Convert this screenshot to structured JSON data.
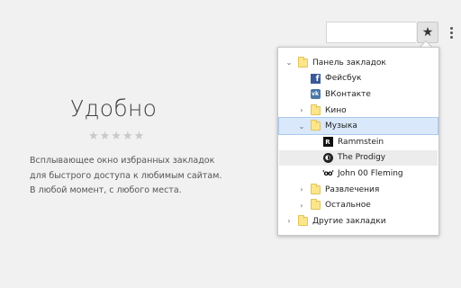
{
  "promo": {
    "title": "Удобно",
    "rating": "★★★★★",
    "description": [
      "Всплывающее окно избранных закладок",
      "для быстрого доступа к любимым сайтам.",
      "В любой момент, с любого места."
    ]
  },
  "toolbar": {
    "bookmark_star": "★"
  },
  "bookmarks": {
    "bar": "Панель закладок",
    "facebook": "Фейсбук",
    "vkontakte": "ВКонтакте",
    "kino": "Кино",
    "music": "Музыка",
    "rammstein": "Rammstein",
    "prodigy": "The Prodigy",
    "john": "John 00 Fleming",
    "entertainment": "Развлечения",
    "other": "Остальное",
    "other_bookmarks": "Другие закладки"
  },
  "icons": {
    "chevron_expanded": "⌄",
    "chevron_collapsed": "›",
    "facebook_glyph": "f",
    "vk_glyph": "vk",
    "rammstein_glyph": "R",
    "prodigy_glyph": "◐",
    "john_glyph": "'oo'"
  },
  "colors": {
    "selected_row": "#d9e8fb",
    "hovered_row": "#ececec",
    "folder": "#fde58a"
  }
}
